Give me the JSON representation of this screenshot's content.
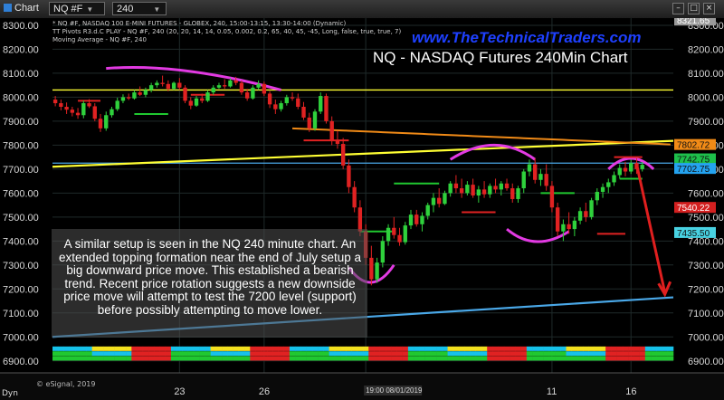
{
  "window": {
    "app_label": "Chart",
    "symbol": "NQ #F",
    "interval": "240",
    "controls": [
      "minimize-icon",
      "restore-icon",
      "close-icon"
    ]
  },
  "overlay": {
    "url": "www.TheTechnicalTraders.com",
    "title": "NQ - NASDAQ Futures 240Min Chart",
    "commentary": "A similar setup is seen in the NQ 240 minute chart. An extended topping formation near the end of July setup a big downward price move.  This established a bearish trend.  Recent price rotation suggests a new downside price move will attempt to test the 7200 level (support) before possibly attempting to move lower."
  },
  "studies": [
    "* NQ #F, NASDAQ 100 E-MINI FUTURES - GLOBEX, 240, 15:00-13:15, 13:30-14:00 (Dynamic)",
    "TT Pivots R3.d.C PLAY - NQ #F, 240 (20, 20, 14, 14, 0.05, 0.002, 0.2, 65, 40, 45, -45, Long, false, true, true, 7)",
    "Moving Average - NQ #F, 240"
  ],
  "footer": {
    "provider": "© eSignal, 2019",
    "left_label": "Dyn"
  },
  "price_tags": [
    {
      "label": "8321.65",
      "color": "#9a9a9a",
      "text_color": "#ffffff"
    },
    {
      "label": "7802.72",
      "color": "#f08a17",
      "text_color": "#111111"
    },
    {
      "label": "7742.75",
      "color": "#1ec04b",
      "text_color": "#111111"
    },
    {
      "label": "7702.75",
      "color": "#24a3f0",
      "text_color": "#111111"
    },
    {
      "label": "7540.22",
      "color": "#d42020",
      "text_color": "#ffffff"
    },
    {
      "label": "7435.50",
      "color": "#48d2e2",
      "text_color": "#111111"
    }
  ],
  "colors": {
    "background": "#000000",
    "grid": "#1f2a2a",
    "axis_text": "#d8d8d8",
    "up_candle": "#2fd13c",
    "down_candle": "#e02222",
    "resistance_line": "#ffff33",
    "support_line": "#4aa8e8",
    "pattern_arc": "#e23ae2",
    "forecast_arrow": "#e01f1f"
  },
  "chart_data": {
    "type": "candlestick",
    "symbol": "NQ #F",
    "interval": "240",
    "ylim": [
      6850,
      8330
    ],
    "y_ticks": [
      6900,
      7000,
      7100,
      7200,
      7300,
      7400,
      7500,
      7600,
      7700,
      7800,
      7900,
      8000,
      8100,
      8200,
      8300
    ],
    "y_tick_labels": [
      "6900.00",
      "7000.00",
      "7100.00",
      "7200.00",
      "7300.00",
      "7400.00",
      "7500.00",
      "7600.00",
      "7700.00",
      "7800.00",
      "7900.00",
      "8000.00",
      "8100.00",
      "8200.00",
      "8300.00"
    ],
    "x_labels": [
      "23",
      "26",
      "19:00 08/01/2019",
      "11",
      "16"
    ],
    "x_label_bars": [
      22,
      37,
      55,
      88,
      102
    ],
    "bar_count": 110,
    "reference_lines": [
      {
        "kind": "horizontal",
        "price": 8030,
        "color": "#ffff33"
      },
      {
        "kind": "horizontal",
        "price": 7725,
        "color": "#4aa8e8"
      },
      {
        "kind": "trend",
        "from": [
          0,
          7710
        ],
        "to": [
          110,
          7818
        ],
        "color": "#ffff33"
      },
      {
        "kind": "trend",
        "from": [
          0,
          7000
        ],
        "to": [
          110,
          7165
        ],
        "color": "#4aa8e8"
      }
    ],
    "forecast": {
      "from_bar": 103,
      "from_price": 7720,
      "to_bar": 108,
      "to_price": 7185
    },
    "candles": [
      {
        "o": 7990,
        "h": 8005,
        "l": 7962,
        "c": 7975
      },
      {
        "o": 7975,
        "h": 7990,
        "l": 7945,
        "c": 7960
      },
      {
        "o": 7960,
        "h": 7978,
        "l": 7930,
        "c": 7948
      },
      {
        "o": 7948,
        "h": 7960,
        "l": 7920,
        "c": 7935
      },
      {
        "o": 7935,
        "h": 7955,
        "l": 7910,
        "c": 7925
      },
      {
        "o": 7925,
        "h": 7985,
        "l": 7912,
        "c": 7975
      },
      {
        "o": 7975,
        "h": 7992,
        "l": 7955,
        "c": 7962
      },
      {
        "o": 7962,
        "h": 7975,
        "l": 7900,
        "c": 7910
      },
      {
        "o": 7910,
        "h": 7930,
        "l": 7855,
        "c": 7870
      },
      {
        "o": 7870,
        "h": 7940,
        "l": 7860,
        "c": 7925
      },
      {
        "o": 7925,
        "h": 7960,
        "l": 7915,
        "c": 7950
      },
      {
        "o": 7950,
        "h": 7998,
        "l": 7942,
        "c": 7985
      },
      {
        "o": 7985,
        "h": 8012,
        "l": 7975,
        "c": 8000
      },
      {
        "o": 8000,
        "h": 8015,
        "l": 7988,
        "c": 7995
      },
      {
        "o": 7995,
        "h": 8030,
        "l": 7990,
        "c": 8020
      },
      {
        "o": 8020,
        "h": 8045,
        "l": 8005,
        "c": 8010
      },
      {
        "o": 8010,
        "h": 8040,
        "l": 8000,
        "c": 8030
      },
      {
        "o": 8030,
        "h": 8060,
        "l": 8020,
        "c": 8050
      },
      {
        "o": 8050,
        "h": 8070,
        "l": 8040,
        "c": 8060
      },
      {
        "o": 8060,
        "h": 8090,
        "l": 8045,
        "c": 8055
      },
      {
        "o": 8055,
        "h": 8070,
        "l": 8025,
        "c": 8035
      },
      {
        "o": 8035,
        "h": 8065,
        "l": 8030,
        "c": 8060
      },
      {
        "o": 8060,
        "h": 8080,
        "l": 8030,
        "c": 8040
      },
      {
        "o": 8040,
        "h": 8050,
        "l": 7975,
        "c": 7985
      },
      {
        "o": 7985,
        "h": 8000,
        "l": 7950,
        "c": 7965
      },
      {
        "o": 7965,
        "h": 8005,
        "l": 7960,
        "c": 7995
      },
      {
        "o": 7995,
        "h": 8015,
        "l": 7975,
        "c": 7985
      },
      {
        "o": 7985,
        "h": 8030,
        "l": 7980,
        "c": 8020
      },
      {
        "o": 8020,
        "h": 8050,
        "l": 8010,
        "c": 8040
      },
      {
        "o": 8040,
        "h": 8060,
        "l": 8035,
        "c": 8050
      },
      {
        "o": 8050,
        "h": 8075,
        "l": 8035,
        "c": 8045
      },
      {
        "o": 8045,
        "h": 8080,
        "l": 8040,
        "c": 8070
      },
      {
        "o": 8070,
        "h": 8085,
        "l": 8050,
        "c": 8060
      },
      {
        "o": 8060,
        "h": 8070,
        "l": 8010,
        "c": 8020
      },
      {
        "o": 8020,
        "h": 8035,
        "l": 7985,
        "c": 7995
      },
      {
        "o": 7995,
        "h": 8050,
        "l": 7990,
        "c": 8040
      },
      {
        "o": 8040,
        "h": 8070,
        "l": 8030,
        "c": 8055
      },
      {
        "o": 8055,
        "h": 8065,
        "l": 8005,
        "c": 8015
      },
      {
        "o": 8015,
        "h": 8025,
        "l": 7955,
        "c": 7970
      },
      {
        "o": 7970,
        "h": 7990,
        "l": 7930,
        "c": 7950
      },
      {
        "o": 7950,
        "h": 7985,
        "l": 7940,
        "c": 7975
      },
      {
        "o": 7975,
        "h": 8010,
        "l": 7965,
        "c": 8000
      },
      {
        "o": 8000,
        "h": 8020,
        "l": 7985,
        "c": 7995
      },
      {
        "o": 7995,
        "h": 8015,
        "l": 7950,
        "c": 7960
      },
      {
        "o": 7960,
        "h": 7980,
        "l": 7905,
        "c": 7915
      },
      {
        "o": 7915,
        "h": 7935,
        "l": 7855,
        "c": 7870
      },
      {
        "o": 7870,
        "h": 7950,
        "l": 7860,
        "c": 7940
      },
      {
        "o": 7940,
        "h": 8020,
        "l": 7930,
        "c": 8005
      },
      {
        "o": 8005,
        "h": 8015,
        "l": 7890,
        "c": 7900
      },
      {
        "o": 7900,
        "h": 7920,
        "l": 7800,
        "c": 7820
      },
      {
        "o": 7820,
        "h": 7860,
        "l": 7785,
        "c": 7805
      },
      {
        "o": 7805,
        "h": 7830,
        "l": 7700,
        "c": 7715
      },
      {
        "o": 7715,
        "h": 7740,
        "l": 7600,
        "c": 7625
      },
      {
        "o": 7625,
        "h": 7650,
        "l": 7520,
        "c": 7540
      },
      {
        "o": 7540,
        "h": 7570,
        "l": 7420,
        "c": 7440
      },
      {
        "o": 7440,
        "h": 7470,
        "l": 7300,
        "c": 7330
      },
      {
        "o": 7330,
        "h": 7380,
        "l": 7215,
        "c": 7240
      },
      {
        "o": 7240,
        "h": 7330,
        "l": 7225,
        "c": 7310
      },
      {
        "o": 7310,
        "h": 7420,
        "l": 7290,
        "c": 7400
      },
      {
        "o": 7400,
        "h": 7470,
        "l": 7380,
        "c": 7455
      },
      {
        "o": 7455,
        "h": 7500,
        "l": 7410,
        "c": 7425
      },
      {
        "o": 7425,
        "h": 7455,
        "l": 7380,
        "c": 7395
      },
      {
        "o": 7395,
        "h": 7480,
        "l": 7385,
        "c": 7465
      },
      {
        "o": 7465,
        "h": 7530,
        "l": 7450,
        "c": 7510
      },
      {
        "o": 7510,
        "h": 7530,
        "l": 7460,
        "c": 7470
      },
      {
        "o": 7470,
        "h": 7520,
        "l": 7440,
        "c": 7505
      },
      {
        "o": 7505,
        "h": 7560,
        "l": 7490,
        "c": 7550
      },
      {
        "o": 7550,
        "h": 7600,
        "l": 7520,
        "c": 7580
      },
      {
        "o": 7580,
        "h": 7620,
        "l": 7540,
        "c": 7555
      },
      {
        "o": 7555,
        "h": 7610,
        "l": 7550,
        "c": 7600
      },
      {
        "o": 7600,
        "h": 7650,
        "l": 7585,
        "c": 7640
      },
      {
        "o": 7640,
        "h": 7675,
        "l": 7600,
        "c": 7620
      },
      {
        "o": 7620,
        "h": 7660,
        "l": 7580,
        "c": 7600
      },
      {
        "o": 7600,
        "h": 7650,
        "l": 7590,
        "c": 7635
      },
      {
        "o": 7635,
        "h": 7660,
        "l": 7580,
        "c": 7590
      },
      {
        "o": 7590,
        "h": 7630,
        "l": 7560,
        "c": 7615
      },
      {
        "o": 7615,
        "h": 7650,
        "l": 7580,
        "c": 7595
      },
      {
        "o": 7595,
        "h": 7640,
        "l": 7580,
        "c": 7630
      },
      {
        "o": 7630,
        "h": 7660,
        "l": 7600,
        "c": 7615
      },
      {
        "o": 7615,
        "h": 7650,
        "l": 7590,
        "c": 7640
      },
      {
        "o": 7640,
        "h": 7660,
        "l": 7610,
        "c": 7620
      },
      {
        "o": 7620,
        "h": 7640,
        "l": 7560,
        "c": 7575
      },
      {
        "o": 7575,
        "h": 7630,
        "l": 7560,
        "c": 7620
      },
      {
        "o": 7620,
        "h": 7700,
        "l": 7600,
        "c": 7690
      },
      {
        "o": 7690,
        "h": 7740,
        "l": 7670,
        "c": 7720
      },
      {
        "o": 7720,
        "h": 7745,
        "l": 7640,
        "c": 7655
      },
      {
        "o": 7655,
        "h": 7700,
        "l": 7630,
        "c": 7680
      },
      {
        "o": 7680,
        "h": 7720,
        "l": 7610,
        "c": 7630
      },
      {
        "o": 7630,
        "h": 7650,
        "l": 7520,
        "c": 7540
      },
      {
        "o": 7540,
        "h": 7560,
        "l": 7420,
        "c": 7440
      },
      {
        "o": 7440,
        "h": 7490,
        "l": 7400,
        "c": 7470
      },
      {
        "o": 7470,
        "h": 7520,
        "l": 7430,
        "c": 7450
      },
      {
        "o": 7450,
        "h": 7500,
        "l": 7420,
        "c": 7485
      },
      {
        "o": 7485,
        "h": 7540,
        "l": 7470,
        "c": 7525
      },
      {
        "o": 7525,
        "h": 7560,
        "l": 7480,
        "c": 7500
      },
      {
        "o": 7500,
        "h": 7580,
        "l": 7490,
        "c": 7570
      },
      {
        "o": 7570,
        "h": 7620,
        "l": 7550,
        "c": 7605
      },
      {
        "o": 7605,
        "h": 7640,
        "l": 7580,
        "c": 7625
      },
      {
        "o": 7625,
        "h": 7660,
        "l": 7600,
        "c": 7645
      },
      {
        "o": 7645,
        "h": 7690,
        "l": 7630,
        "c": 7675
      },
      {
        "o": 7675,
        "h": 7720,
        "l": 7660,
        "c": 7705
      },
      {
        "o": 7705,
        "h": 7730,
        "l": 7670,
        "c": 7690
      },
      {
        "o": 7690,
        "h": 7740,
        "l": 7680,
        "c": 7725
      },
      {
        "o": 7725,
        "h": 7745,
        "l": 7680,
        "c": 7700
      },
      {
        "o": 7700,
        "h": 7730,
        "l": 7690,
        "c": 7718
      }
    ]
  }
}
